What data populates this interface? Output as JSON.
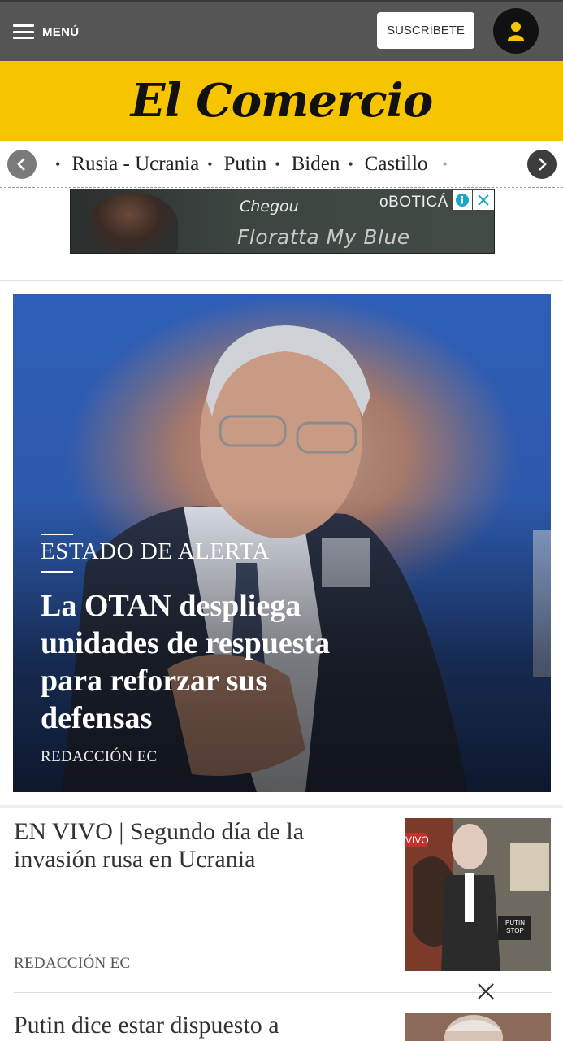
{
  "header": {
    "menu_label": "MENÚ",
    "subscribe_label": "SUSCRÍBETE",
    "logo_text": "El Comercio",
    "accent_color": "#f7c400",
    "bar_color": "#555555"
  },
  "topics": {
    "items": [
      "Rusia - Ucrania",
      "Putin",
      "Biden",
      "Castillo"
    ]
  },
  "ad": {
    "line1": "Chegou",
    "line2": "Floratta My Blue",
    "brand": "oBOTICÁ"
  },
  "hero": {
    "kicker": "ESTADO DE ALERTA",
    "title": "La OTAN despliega unidades de respuesta para reforzar sus defensas",
    "author": "REDACCIÓN EC"
  },
  "stories": [
    {
      "title": "EN VIVO | Segundo día de la invasión rusa en Ucrania",
      "author": "REDACCIÓN EC",
      "thumb_labels": [
        "VIVO",
        "PUTIN STOP"
      ]
    },
    {
      "title": "Putin dice estar dispuesto a",
      "author": ""
    }
  ]
}
